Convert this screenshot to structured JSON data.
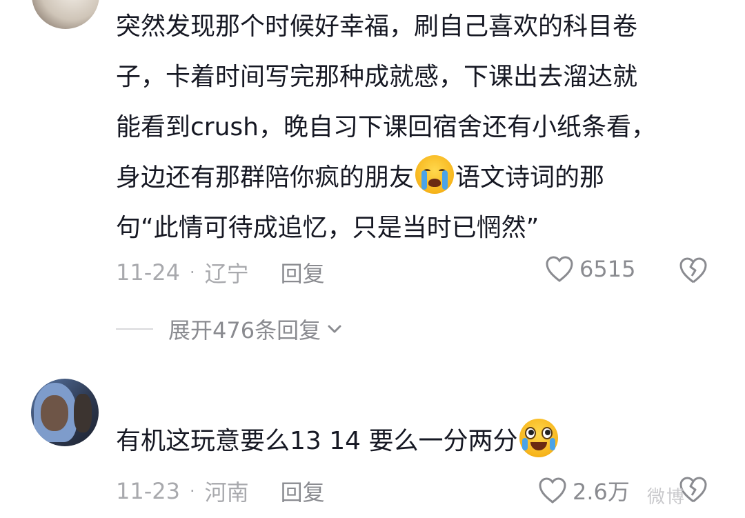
{
  "comments": [
    {
      "lines": [
        "突然发现那个时候好幸福，刷自己喜欢的科目卷",
        "子，卡着时间写完那种成就感，下课出去溜达就",
        "能看到crush，晚自习下课回宿舍还有小纸条看，",
        "身边还有那群陪你疯的朋友",
        "语文诗词的那",
        "句“此情可待成追忆，只是当时已惘然”"
      ],
      "date": "11-24",
      "separator": "·",
      "location": "辽宁",
      "reply_label": "回复",
      "like_count": "6515",
      "expand_label": "展开476条回复",
      "emoji": "loudly-crying-emoji"
    },
    {
      "text": "有机这玩意要么13 14 要么一分两分",
      "date": "11-23",
      "separator": "·",
      "location": "河南",
      "reply_label": "回复",
      "like_count": "2.6万",
      "emoji": "holding-back-tears-emoji"
    }
  ],
  "watermark": "微博",
  "colors": {
    "text": "#161823",
    "meta": "#a8a9ad",
    "action": "#8a8b90"
  }
}
